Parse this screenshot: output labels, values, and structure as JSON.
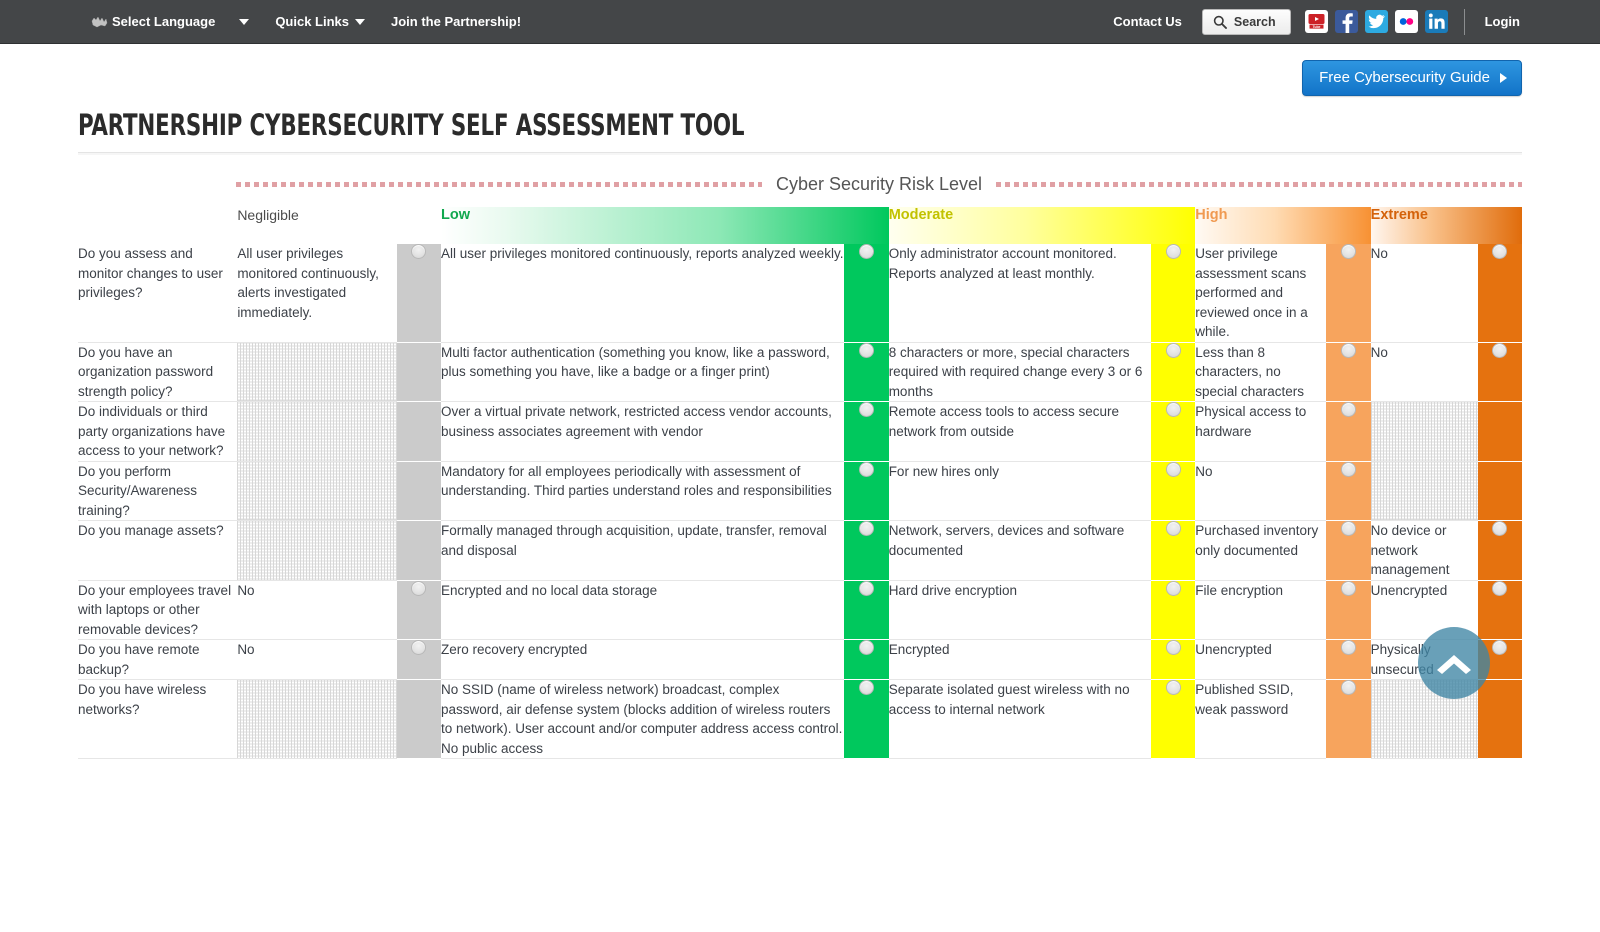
{
  "topnav": {
    "select_language": "Select Language",
    "quick_links": "Quick Links",
    "join": "Join the Partnership!",
    "contact_us": "Contact Us",
    "search": "Search",
    "login": "Login",
    "social": [
      {
        "name": "youtube-icon",
        "label": "YouTube",
        "color": "#ffffff"
      },
      {
        "name": "facebook-icon",
        "label": "Facebook",
        "color": "#3b5a9b"
      },
      {
        "name": "twitter-icon",
        "label": "Twitter",
        "color": "#2daae1"
      },
      {
        "name": "flickr-icon",
        "label": "Flickr",
        "color": "#ffffff"
      },
      {
        "name": "linkedin-icon",
        "label": "LinkedIn",
        "color": "#1a7bb9"
      }
    ]
  },
  "header": {
    "guide_button": "Free Cybersecurity Guide",
    "page_title": "Partnership Cybersecurity Self Assessment Tool"
  },
  "risk_banner": {
    "label": "Cyber Security Risk Level"
  },
  "columns": {
    "negligible": "Negligible",
    "low": "Low",
    "moderate": "Moderate",
    "high": "High",
    "extreme": "Extreme"
  },
  "colors": {
    "negligible_strip": "#cbcbcb",
    "low_strip": "#00c85d",
    "moderate_strip": "#ffff00",
    "high_strip": "#f7a45d",
    "extreme_strip": "#e5720f",
    "accent_blue": "#1273c8",
    "nav_background": "#444648",
    "dotted_rule": "#e0a0a4",
    "scroll_top": "#3f85a4"
  },
  "rows": [
    {
      "question": "Do you assess and monitor changes to user privileges?",
      "negligible": "All user privileges monitored continuously, alerts investigated immediately.",
      "negligible_disabled": false,
      "low": "All user privileges monitored continuously, reports analyzed weekly.",
      "low_disabled": false,
      "moderate": "Only administrator account monitored. Reports analyzed at least monthly.",
      "moderate_disabled": false,
      "high": "User privilege assessment scans performed and reviewed once in a while.",
      "high_disabled": false,
      "extreme": "No",
      "extreme_disabled": false
    },
    {
      "question": "Do you have an organization password strength policy?",
      "negligible": "",
      "negligible_disabled": true,
      "low": "Multi factor authentication (something you know, like a password, plus something you have, like a badge or a finger print)",
      "low_disabled": false,
      "moderate": "8 characters or more, special characters required with required change every 3 or 6 months",
      "moderate_disabled": false,
      "high": "Less than 8 characters, no special characters",
      "high_disabled": false,
      "extreme": "No",
      "extreme_disabled": false
    },
    {
      "question": "Do individuals or third party organizations have access to your network?",
      "negligible": "",
      "negligible_disabled": true,
      "low": "Over a virtual private network, restricted access vendor accounts, business associates agreement with vendor",
      "low_disabled": false,
      "moderate": "Remote access tools to access secure network from outside",
      "moderate_disabled": false,
      "high": "Physical access to hardware",
      "high_disabled": false,
      "extreme": "",
      "extreme_disabled": true
    },
    {
      "question": "Do you perform Security/Awareness training?",
      "negligible": "",
      "negligible_disabled": true,
      "low": "Mandatory for all employees periodically with assessment of understanding. Third parties understand roles and responsibilities",
      "low_disabled": false,
      "moderate": "For new hires only",
      "moderate_disabled": false,
      "high": "No",
      "high_disabled": false,
      "extreme": "",
      "extreme_disabled": true
    },
    {
      "question": "Do you manage assets?",
      "negligible": "",
      "negligible_disabled": true,
      "low": "Formally managed through acquisition, update, transfer, removal and disposal",
      "low_disabled": false,
      "moderate": "Network, servers, devices and software documented",
      "moderate_disabled": false,
      "high": "Purchased inventory only documented",
      "high_disabled": false,
      "extreme": "No device or network management",
      "extreme_disabled": false
    },
    {
      "question": "Do your employees travel with laptops or other removable devices?",
      "negligible": "No",
      "negligible_disabled": false,
      "low": "Encrypted and no local data storage",
      "low_disabled": false,
      "moderate": "Hard drive encryption",
      "moderate_disabled": false,
      "high": "File encryption",
      "high_disabled": false,
      "extreme": "Unencrypted",
      "extreme_disabled": false
    },
    {
      "question": "Do you have remote backup?",
      "negligible": "No",
      "negligible_disabled": false,
      "low": "Zero recovery encrypted",
      "low_disabled": false,
      "moderate": "Encrypted",
      "moderate_disabled": false,
      "high": "Unencrypted",
      "high_disabled": false,
      "extreme": "Physically unsecured",
      "extreme_disabled": false
    },
    {
      "question": "Do you have wireless networks?",
      "negligible": "",
      "negligible_disabled": true,
      "low": "No SSID (name of wireless network) broadcast, complex password, air defense system (blocks addition of wireless routers to network). User account and/or computer address access control. No public access",
      "low_disabled": false,
      "moderate": "Separate isolated guest wireless with no access to internal network",
      "moderate_disabled": false,
      "high": "Published SSID, weak password",
      "high_disabled": false,
      "extreme": "",
      "extreme_disabled": true
    }
  ]
}
